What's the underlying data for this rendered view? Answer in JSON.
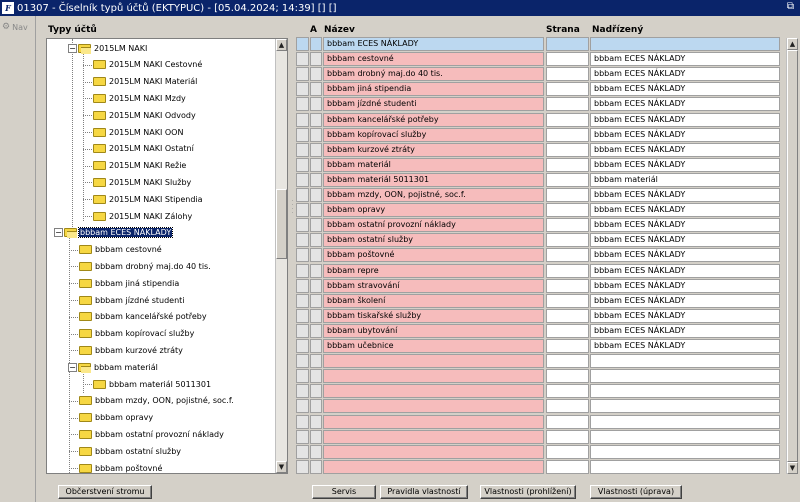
{
  "window": {
    "title": "01307 - Číselník typů účtů (EKTYPUC) - [05.04.2024; 14:39]  []  []",
    "restore_glyph": "⧉"
  },
  "nav": {
    "label": "Nav"
  },
  "tree": {
    "header": "Typy účtů",
    "items": [
      {
        "label": "2015LM NAKI",
        "level": 0,
        "expander": "−",
        "open": true
      },
      {
        "label": "2015LM NAKI Cestovné",
        "level": 1
      },
      {
        "label": "2015LM NAKI Materiál",
        "level": 1
      },
      {
        "label": "2015LM NAKI Mzdy",
        "level": 1
      },
      {
        "label": "2015LM NAKI Odvody",
        "level": 1
      },
      {
        "label": "2015LM NAKI OON",
        "level": 1
      },
      {
        "label": "2015LM NAKI Ostatní",
        "level": 1
      },
      {
        "label": "2015LM NAKI Režie",
        "level": 1
      },
      {
        "label": "2015LM NAKI Služby",
        "level": 1
      },
      {
        "label": "2015LM NAKI Stipendia",
        "level": 1
      },
      {
        "label": "2015LM NAKI Zálohy",
        "level": 1
      },
      {
        "label": "bbbam ECES NÁKLADY",
        "level": -1,
        "expander": "−",
        "open": true,
        "selected": true
      },
      {
        "label": "bbbam cestovné",
        "level": 0
      },
      {
        "label": "bbbam drobný maj.do 40 tis.",
        "level": 0
      },
      {
        "label": "bbbam jiná stipendia",
        "level": 0
      },
      {
        "label": "bbbam jízdné studenti",
        "level": 0
      },
      {
        "label": "bbbam kancelářské potřeby",
        "level": 0
      },
      {
        "label": "bbbam kopírovací služby",
        "level": 0
      },
      {
        "label": "bbbam kurzové ztráty",
        "level": 0
      },
      {
        "label": "bbbam materiál",
        "level": 0,
        "expander": "−",
        "open": true
      },
      {
        "label": "bbbam materiál 5011301",
        "level": 1
      },
      {
        "label": "bbbam mzdy, OON, pojistné, soc.f.",
        "level": 0
      },
      {
        "label": "bbbam opravy",
        "level": 0
      },
      {
        "label": "bbbam ostatní provozní náklady",
        "level": 0
      },
      {
        "label": "bbbam ostatní služby",
        "level": 0
      },
      {
        "label": "bbbam poštovné",
        "level": 0
      }
    ]
  },
  "grid": {
    "col_a": "A",
    "col_name": "Název",
    "col_strana": "Strana",
    "col_nadrizeny": "Nadřízený",
    "rows": [
      {
        "name": "bbbam ECES NÁKLADY",
        "strana": "",
        "nadrizeny": "",
        "style": "hdr"
      },
      {
        "name": "bbbam cestovné",
        "strana": "",
        "nadrizeny": "bbbam ECES NÁKLADY"
      },
      {
        "name": "bbbam drobný maj.do 40 tis.",
        "strana": "",
        "nadrizeny": "bbbam ECES NÁKLADY"
      },
      {
        "name": "bbbam jiná stipendia",
        "strana": "",
        "nadrizeny": "bbbam ECES NÁKLADY"
      },
      {
        "name": "bbbam jízdné studenti",
        "strana": "",
        "nadrizeny": "bbbam ECES NÁKLADY"
      },
      {
        "name": "bbbam kancelářské potřeby",
        "strana": "",
        "nadrizeny": "bbbam ECES NÁKLADY"
      },
      {
        "name": "bbbam kopírovací služby",
        "strana": "",
        "nadrizeny": "bbbam ECES NÁKLADY"
      },
      {
        "name": "bbbam kurzové ztráty",
        "strana": "",
        "nadrizeny": "bbbam ECES NÁKLADY"
      },
      {
        "name": "bbbam materiál",
        "strana": "",
        "nadrizeny": "bbbam ECES NÁKLADY"
      },
      {
        "name": "  bbbam materiál 5011301",
        "strana": "",
        "nadrizeny": "bbbam materiál"
      },
      {
        "name": "bbbam mzdy, OON, pojistné, soc.f.",
        "strana": "",
        "nadrizeny": "bbbam ECES NÁKLADY"
      },
      {
        "name": "bbbam opravy",
        "strana": "",
        "nadrizeny": "bbbam ECES NÁKLADY"
      },
      {
        "name": "bbbam ostatní provozní náklady",
        "strana": "",
        "nadrizeny": "bbbam ECES NÁKLADY"
      },
      {
        "name": "bbbam ostatní služby",
        "strana": "",
        "nadrizeny": "bbbam ECES NÁKLADY"
      },
      {
        "name": "bbbam poštovné",
        "strana": "",
        "nadrizeny": "bbbam ECES NÁKLADY"
      },
      {
        "name": "bbbam repre",
        "strana": "",
        "nadrizeny": "bbbam ECES NÁKLADY"
      },
      {
        "name": "bbbam stravování",
        "strana": "",
        "nadrizeny": "bbbam ECES NÁKLADY"
      },
      {
        "name": "bbbam školení",
        "strana": "",
        "nadrizeny": "bbbam ECES NÁKLADY"
      },
      {
        "name": "bbbam tiskařské služby",
        "strana": "",
        "nadrizeny": "bbbam ECES NÁKLADY"
      },
      {
        "name": "bbbam ubytování",
        "strana": "",
        "nadrizeny": "bbbam ECES NÁKLADY"
      },
      {
        "name": "bbbam učebnice",
        "strana": "",
        "nadrizeny": "bbbam ECES NÁKLADY"
      },
      {
        "name": "",
        "strana": "",
        "nadrizeny": ""
      },
      {
        "name": "",
        "strana": "",
        "nadrizeny": ""
      },
      {
        "name": "",
        "strana": "",
        "nadrizeny": ""
      },
      {
        "name": "",
        "strana": "",
        "nadrizeny": ""
      },
      {
        "name": "",
        "strana": "",
        "nadrizeny": ""
      },
      {
        "name": "",
        "strana": "",
        "nadrizeny": ""
      },
      {
        "name": "",
        "strana": "",
        "nadrizeny": ""
      },
      {
        "name": "",
        "strana": "",
        "nadrizeny": ""
      }
    ]
  },
  "buttons": {
    "refresh_tree": "Občerstvení stromu",
    "servis": "Servis",
    "pravidla": "Pravidla vlastností",
    "vlastnosti_prohlizeni": "Vlastnosti (prohlížení)",
    "vlastnosti_uprava": "Vlastnosti (úprava)"
  },
  "colors": {
    "titlebar": "#0a246a",
    "row_name_bg": "#f6bcbc",
    "header_row_bg": "#bcd8f0",
    "folder": "#f6d743"
  }
}
